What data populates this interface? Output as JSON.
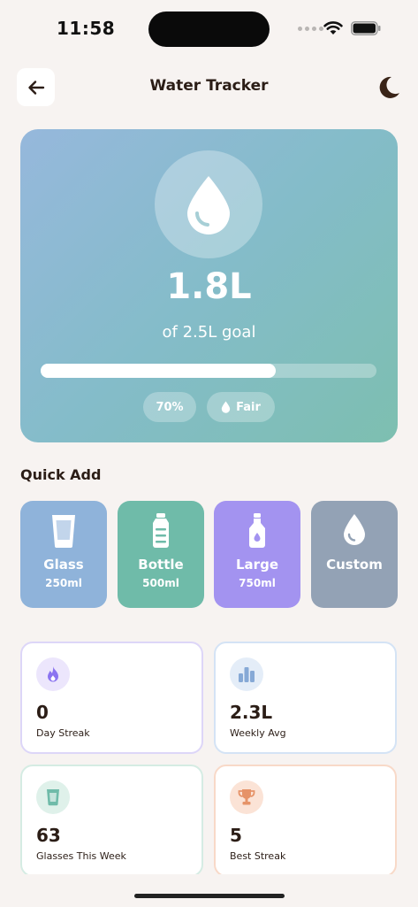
{
  "status_bar": {
    "time": "11:58"
  },
  "header": {
    "title": "Water Tracker",
    "back_icon": "arrow-left-icon",
    "theme_icon": "moon-icon"
  },
  "hero": {
    "amount": "1.8L",
    "goal_text": "of 2.5L goal",
    "progress": 0.7,
    "percent_label": "70%",
    "status_label": "Fair",
    "icon": "water-drop-icon"
  },
  "quick_add": {
    "title": "Quick Add",
    "items": [
      {
        "label": "Glass",
        "amount": "250ml",
        "icon": "glass-icon",
        "color": "#8fb3da"
      },
      {
        "label": "Bottle",
        "amount": "500ml",
        "icon": "bottle-icon",
        "color": "#6fbba9"
      },
      {
        "label": "Large",
        "amount": "750ml",
        "icon": "large-bottle-icon",
        "color": "#a393f0"
      },
      {
        "label": "Custom",
        "amount": "",
        "icon": "water-drop-icon",
        "color": "#93a2b5"
      }
    ]
  },
  "stats": [
    {
      "value": "0",
      "label": "Day Streak",
      "icon": "flame-icon",
      "accent": "#8b74f0"
    },
    {
      "value": "2.3L",
      "label": "Weekly Avg",
      "icon": "bar-chart-icon",
      "accent": "#86a9d6"
    },
    {
      "value": "63",
      "label": "Glasses This Week",
      "icon": "glass-icon",
      "accent": "#6fbba9"
    },
    {
      "value": "5",
      "label": "Best Streak",
      "icon": "trophy-icon",
      "accent": "#e69368"
    }
  ]
}
